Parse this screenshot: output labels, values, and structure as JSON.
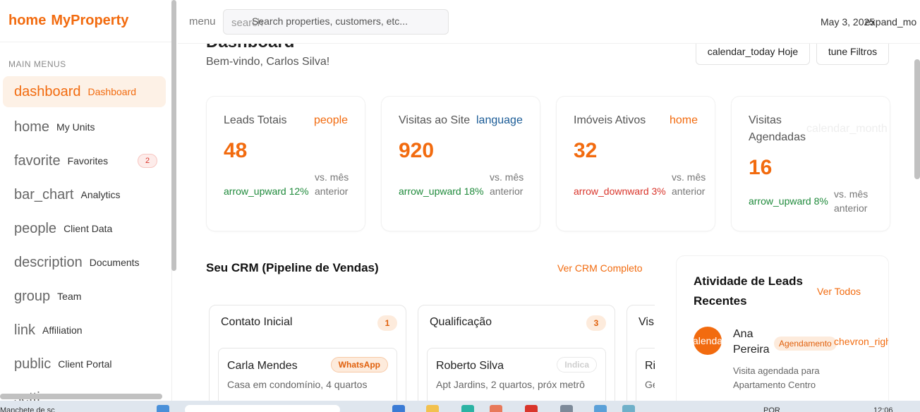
{
  "sidebar": {
    "brand_icon": "home",
    "brand_name": "MyProperty",
    "section_title": "MAIN MENUS",
    "items": [
      {
        "icon": "dashboard",
        "label": "Dashboard",
        "active": true
      },
      {
        "icon": "home",
        "label": "My Units"
      },
      {
        "icon": "favorite",
        "label": "Favorites",
        "badge": "2"
      },
      {
        "icon": "bar_chart",
        "label": "Analytics"
      },
      {
        "icon": "people",
        "label": "Client Data"
      },
      {
        "icon": "description",
        "label": "Documents"
      },
      {
        "icon": "group",
        "label": "Team"
      },
      {
        "icon": "link",
        "label": "Affiliation"
      },
      {
        "icon": "public",
        "label": "Client Portal"
      },
      {
        "icon": "setti",
        "label": ""
      }
    ]
  },
  "topbar": {
    "menu_icon": "menu",
    "search_icon": "search",
    "search_placeholder": "Search properties, customers, etc...",
    "date": "May 3, 2025",
    "expand_icon": "expand_mo"
  },
  "header": {
    "title": "Dashboard",
    "welcome": "Bem-vindo, Carlos Silva!",
    "today_button": "calendar_today Hoje",
    "filters_button": "tune Filtros"
  },
  "kpis": [
    {
      "title": "Leads Totais",
      "icon": "people",
      "value": "48",
      "trend": "arrow_upward 12%",
      "trend_dir": "up",
      "vs": "vs. mês anterior"
    },
    {
      "title": "Visitas ao Site",
      "icon": "language",
      "value": "920",
      "trend": "arrow_upward 18%",
      "trend_dir": "up",
      "vs": "vs. mês anterior"
    },
    {
      "title": "Imóveis Ativos",
      "icon": "home",
      "value": "32",
      "trend": "arrow_downward 3%",
      "trend_dir": "down",
      "vs": "vs. mês anterior"
    },
    {
      "title": "Visitas Agendadas",
      "icon": "calendar_month",
      "value": "16",
      "trend": "arrow_upward 8%",
      "trend_dir": "up",
      "vs": "vs. mês anterior"
    }
  ],
  "crm": {
    "title": "Seu CRM (Pipeline de Vendas)",
    "link": "Ver CRM Completo",
    "columns": [
      {
        "title": "Contato Inicial",
        "count": "1",
        "card": {
          "name": "Carla Mendes",
          "tag": "WhatsApp",
          "desc": "Casa em condomínio, 4 quartos"
        }
      },
      {
        "title": "Qualificação",
        "count": "3",
        "card": {
          "name": "Roberto Silva",
          "tag": "Indica",
          "desc": "Apt Jardins, 2 quartos, próx metrô"
        }
      },
      {
        "title": "Vis",
        "count": "",
        "card": {
          "name": "Ri",
          "tag": "",
          "desc": "Ge"
        }
      }
    ]
  },
  "activity": {
    "title": "Atividade de Leads Recentes",
    "link": "Ver Todos",
    "lead": {
      "avatar_text": "calendar_today",
      "name": "Ana Pereira",
      "tag": "Agendamento",
      "chevron": "chevron_right",
      "desc": "Visita agendada para Apartamento Centro"
    }
  },
  "taskbar": {
    "note": "Manchete de sc",
    "lang": "POR",
    "time": "12:06"
  },
  "colors": {
    "accent": "#f26b0f",
    "accent_light": "#fdf1e6",
    "positive": "#1f8a3b",
    "negative": "#d9352b",
    "language_icon": "#1a5b96"
  }
}
